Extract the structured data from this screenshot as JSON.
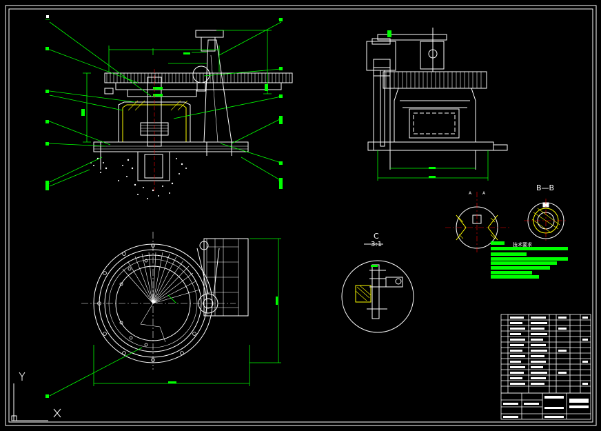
{
  "drawing": {
    "section_bb_label": "B—B",
    "detail_c_label": "C",
    "detail_c_scale": "3:1",
    "section_a_marks": [
      "A",
      "A"
    ],
    "tech_req_title": "技术要求",
    "ucs_x": "X",
    "ucs_y": "Y"
  },
  "colors": {
    "background": "#000000",
    "line": "#ffffff",
    "dimension": "#00ff00",
    "hatch": "#ffff00",
    "center": "#ff0000",
    "highlight": "#00ff00",
    "accent": "#00ffff"
  }
}
